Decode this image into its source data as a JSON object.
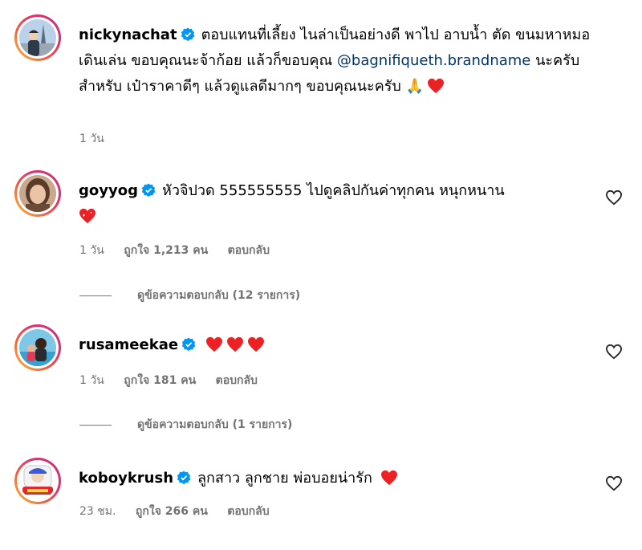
{
  "comments": [
    {
      "username": "nickynachat",
      "text_part1": "ตอบแทนที่เลี้ยง ไนล่าเป็นอย่างดี พาไป อาบน้ำ ตัด ขนมหาหมอ เดินเล่น ขอบคุณนะจ้าก้อย แล้วก็ขอบคุณ",
      "mention": "@bagnifiqueth.brandname",
      "text_part2": "นะครับ สำหรับ เป๋าราคาดีๆ แล้วดูแลดีมากๆ ขอบคุณนะครับ",
      "emoji": "🙏",
      "time": "1 วัน",
      "icon": "heart"
    },
    {
      "username": "goyyog",
      "text": "หัวจิปวด 555555555 ไปดูคลิปกันค่าทุกคน หนุกหนาน",
      "time": "1 วัน",
      "likes": "ถูกใจ 1,213 คน",
      "reply": "ตอบกลับ",
      "view_replies": "ดูข้อความตอบกลับ (12 รายการ)"
    },
    {
      "username": "rusameekae",
      "time": "1 วัน",
      "likes": "ถูกใจ 181 คน",
      "reply": "ตอบกลับ",
      "view_replies": "ดูข้อความตอบกลับ (1 รายการ)"
    },
    {
      "username": "koboykrush",
      "text": "ลูกสาว ลูกชาย พ่อบอยน่ารัก",
      "time": "23 ชม.",
      "likes": "ถูกใจ 266 คน",
      "reply": "ตอบกลับ"
    }
  ],
  "colors": {
    "verified": "#0095f6",
    "heart": "#ed2024",
    "meta": "#737373",
    "mention": "#00376b"
  }
}
